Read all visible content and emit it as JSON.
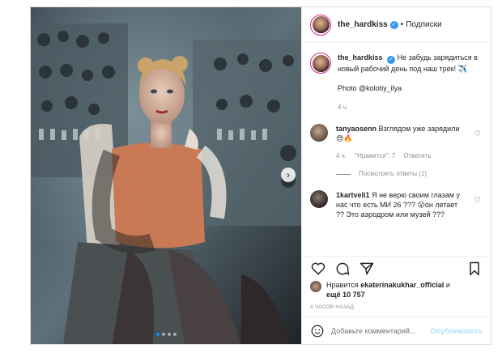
{
  "post": {
    "username": "the_hardkiss",
    "follow_label": "Подписки",
    "separator": "•",
    "caption": {
      "username": "the_hardkiss",
      "text": "Не забудь зарядиться в новый рабочий день под наш трек! ✈️",
      "photo_credit": "Photo @kolotiy_ilya",
      "time": "4 ч."
    },
    "comments": [
      {
        "username": "tanyaosenn",
        "text": "Взглядом уже зарядили 😍🔥",
        "time": "4 ч.",
        "likes": "\"Нравится\": 7",
        "reply": "Ответить",
        "avatar_color": "#6b5a4e"
      },
      {
        "username": "1kartveli1",
        "text": "Я не верю своим глазам у нас что есть МИ 26 ??? 😮он летает ?? Это аэродром или музей ???",
        "avatar_color": "#3a3030"
      }
    ],
    "view_replies": "Посмотреть ответы (1)",
    "likes_text_prefix": "Нравится",
    "likes_user": "ekaterinakukhar_official",
    "likes_suffix": "и",
    "likes_more": "ещё 10 757",
    "timestamp": "4 ЧАСОВ НАЗАД",
    "add_comment_placeholder": "Добавьте комментарий...",
    "publish_label": "Опубликовать",
    "carousel": {
      "current": 1,
      "total": 4
    },
    "colors": {
      "accent": "#0095f6",
      "verified": "#3897f0",
      "story_ring": "#d6249f"
    }
  },
  "icons": {
    "verified": "verified-badge-icon",
    "heart": "heart-icon",
    "comment": "comment-icon",
    "share": "share-icon",
    "save": "bookmark-icon",
    "emoji": "smile-icon",
    "next": "chevron-right-icon"
  }
}
